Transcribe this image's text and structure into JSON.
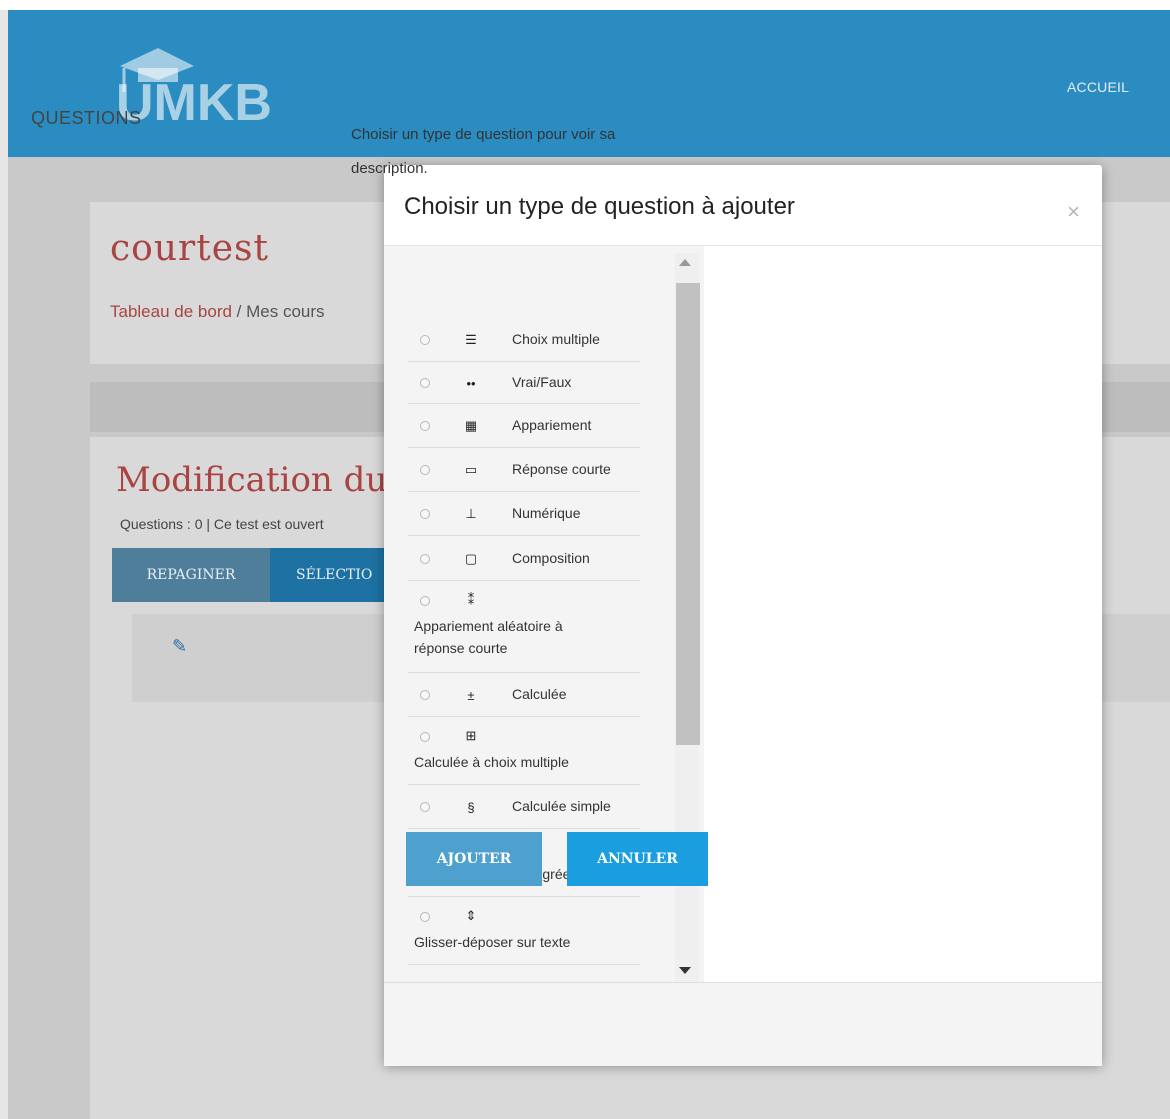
{
  "header": {
    "logo_text": "UMKB",
    "nav_home": "ACCUEIL",
    "brand_color": "#2a8cc0"
  },
  "course": {
    "title": "courtest",
    "breadcrumb_home": "Tableau de bord",
    "breadcrumb_sep": "/",
    "breadcrumb_current": "Mes cours"
  },
  "quiz": {
    "edit_title": "Modification du",
    "info": "Questions : 0 | Ce test est ouvert",
    "repaginate_label": "REPAGINER",
    "select_label": "SÉLECTIO",
    "pencil_icon": "pencil-icon"
  },
  "modal": {
    "title": "Choisir un type de question à ajouter",
    "close_symbol": "×",
    "options_heading": "QUESTIONS",
    "description": "Choisir un type de question pour voir sa description.",
    "add_label": "AJOUTER",
    "cancel_label": "ANNULER",
    "options": [
      {
        "label": "Choix multiple",
        "icon": "multichoice-icon"
      },
      {
        "label": "Vrai/Faux",
        "icon": "truefalse-icon"
      },
      {
        "label": "Appariement",
        "icon": "match-icon"
      },
      {
        "label": "Réponse courte",
        "icon": "shortanswer-icon"
      },
      {
        "label": "Numérique",
        "icon": "numerical-icon"
      },
      {
        "label": "Composition",
        "icon": "essay-icon"
      },
      {
        "label": "Appariement aléatoire à réponse courte",
        "icon": "randomsamatch-icon"
      },
      {
        "label": "Calculée",
        "icon": "calculated-icon"
      },
      {
        "label": "Calculée à choix multiple",
        "icon": "calculatedmulti-icon"
      },
      {
        "label": "Calculée simple",
        "icon": "calculatedsimple-icon"
      },
      {
        "label": "Cloze (réponses intégrées)",
        "icon": "cloze-icon"
      },
      {
        "label": "Glisser-déposer sur texte",
        "icon": "ddwtos-icon"
      }
    ]
  }
}
